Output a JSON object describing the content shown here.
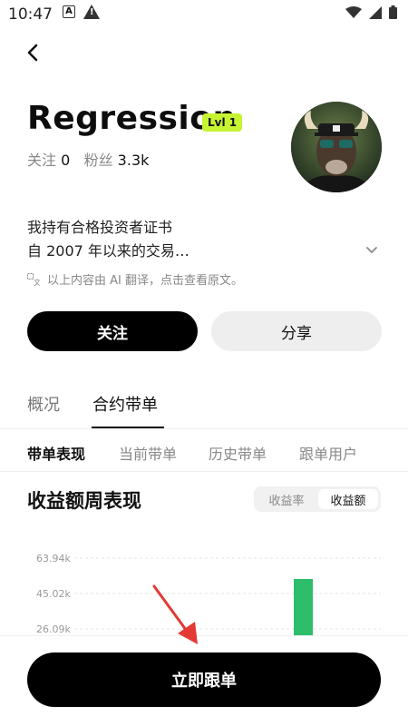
{
  "status_bar": {
    "time": "10:47",
    "icons": [
      "a-icon",
      "warning-icon",
      "wifi-icon",
      "signal-icon",
      "battery-icon"
    ]
  },
  "header": {
    "username": "Regression",
    "level_badge": "Lvl 1",
    "following_label": "关注",
    "following_count": "0",
    "followers_label": "粉丝",
    "followers_count": "3.3k"
  },
  "bio": {
    "line1": "我持有合格投资者证书",
    "line2": "自 2007 年以来的交易…",
    "translation_note": "以上内容由 AI 翻译，点击查看原文。"
  },
  "actions": {
    "follow_label": "关注",
    "share_label": "分享"
  },
  "tabs": {
    "overview": "概况",
    "copy_trading": "合约带单"
  },
  "subtabs": [
    "带单表现",
    "当前带单",
    "历史带单",
    "跟单用户"
  ],
  "section": {
    "title": "收益额周表现",
    "toggle_rate": "收益率",
    "toggle_amount": "收益额"
  },
  "chart_data": {
    "type": "bar",
    "y_ticks": [
      "63.94k",
      "45.02k",
      "26.09k"
    ],
    "bar_color": "#2ebd6b"
  },
  "cta": {
    "label": "立即跟单"
  },
  "colors": {
    "badge": "#c6f432",
    "primary": "#000000",
    "positive": "#2ebd6b",
    "annotation_arrow": "#e53935"
  }
}
